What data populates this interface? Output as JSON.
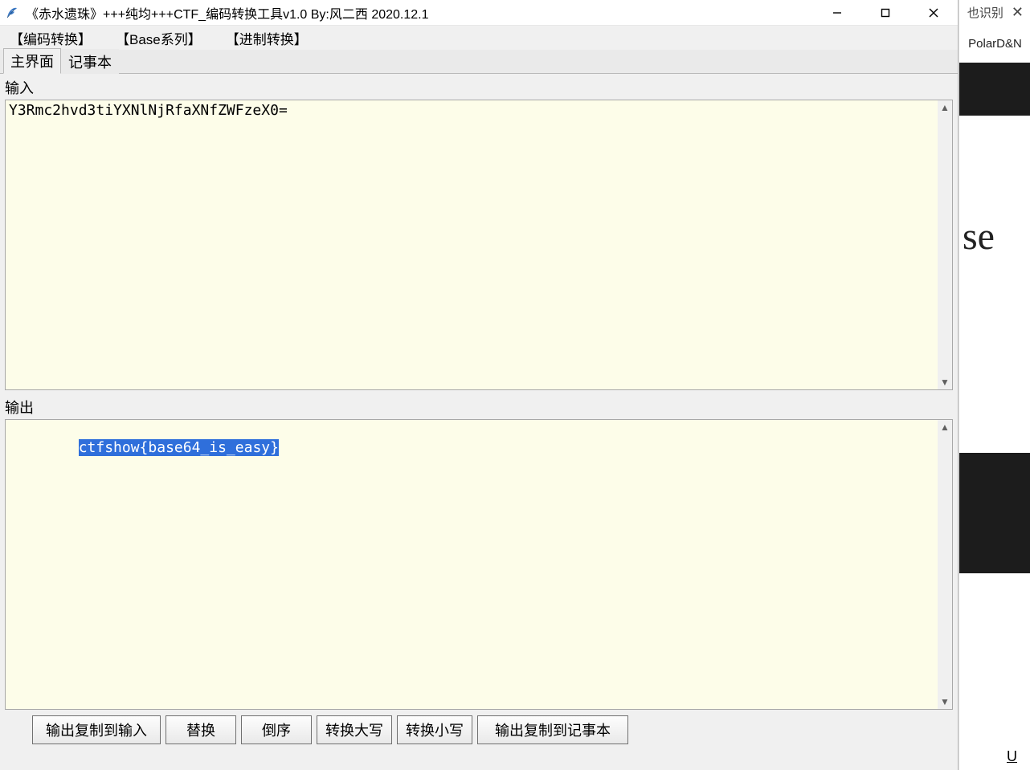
{
  "window": {
    "title": "《赤水遗珠》+++纯均+++CTF_编码转换工具v1.0   By:风二西 2020.12.1"
  },
  "menubar": {
    "items": [
      "【编码转换】",
      "【Base系列】",
      "【进制转换】"
    ]
  },
  "tabs": {
    "items": [
      "主界面",
      "记事本"
    ],
    "active": 0
  },
  "panels": {
    "input_label": "输入",
    "input_value": "Y3Rmc2hvd3tiYXNlNjRfaXNfZWFzeX0=",
    "output_label": "输出",
    "output_value": "ctfshow{base64_is_easy}"
  },
  "buttons": {
    "copy_out_to_in": "输出复制到输入",
    "replace": "替换",
    "reverse": "倒序",
    "to_upper": "转换大写",
    "to_lower": "转换小写",
    "copy_out_to_notepad": "输出复制到记事本"
  },
  "background": {
    "top_fragment": "也识别",
    "close_glyph": "✕",
    "tab_label": "PolarD&N",
    "article_fragment": "se",
    "underline_u": "U"
  }
}
